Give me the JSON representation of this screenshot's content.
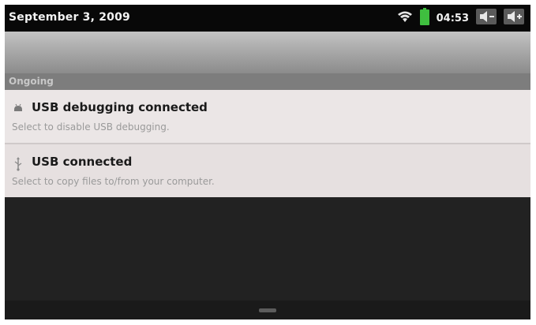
{
  "status_bar": {
    "date": "September 3, 2009",
    "time": "04:53",
    "icons": [
      "wifi-icon",
      "battery-icon",
      "volume-down-icon",
      "volume-up-icon"
    ]
  },
  "section": {
    "label": "Ongoing"
  },
  "notifications": [
    {
      "icon": "android-debug-icon",
      "title": "USB debugging connected",
      "subtitle": "Select to disable USB debugging."
    },
    {
      "icon": "usb-icon",
      "title": "USB connected",
      "subtitle": "Select to copy files to/from your computer."
    }
  ],
  "colors": {
    "battery": "#3fbf3f",
    "status_bar": "#080808",
    "notification_bg": "#ebe6e6"
  }
}
